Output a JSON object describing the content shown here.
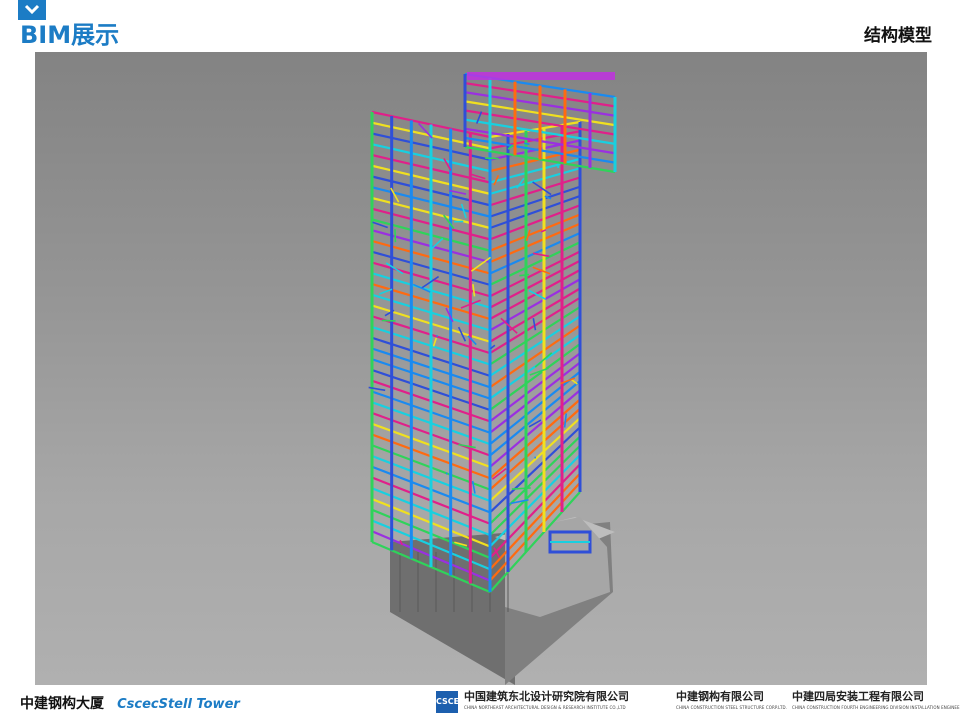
{
  "header": {
    "chevron_icon": "chevron-down-icon",
    "title": "BIM展示",
    "section": "结构模型",
    "accent_color": "#1c7cc5"
  },
  "viewport": {
    "content": "3d-steel-structure-model"
  },
  "footer": {
    "title_cn": "中建钢构大厦",
    "title_en": "CscecStell Tower",
    "logos": [
      {
        "mark": "CSCEC",
        "name": "中国建筑东北设计研究院有限公司",
        "subtitle": "CHINA NORTHEAST ARCHITECTURAL DESIGN & RESEARCH INSTITUTE CO.,LTD"
      },
      {
        "name": "中建钢构有限公司",
        "subtitle": "CHINA CONSTRUCTION STEEL STRUCTURE CORP.LTD."
      },
      {
        "name": "中建四局安装工程有限公司",
        "subtitle": "CHINA CONSTRUCTION FOURTH ENGINEERING DIVISION INSTALLATION ENGINEERING CO.LTD"
      }
    ]
  }
}
